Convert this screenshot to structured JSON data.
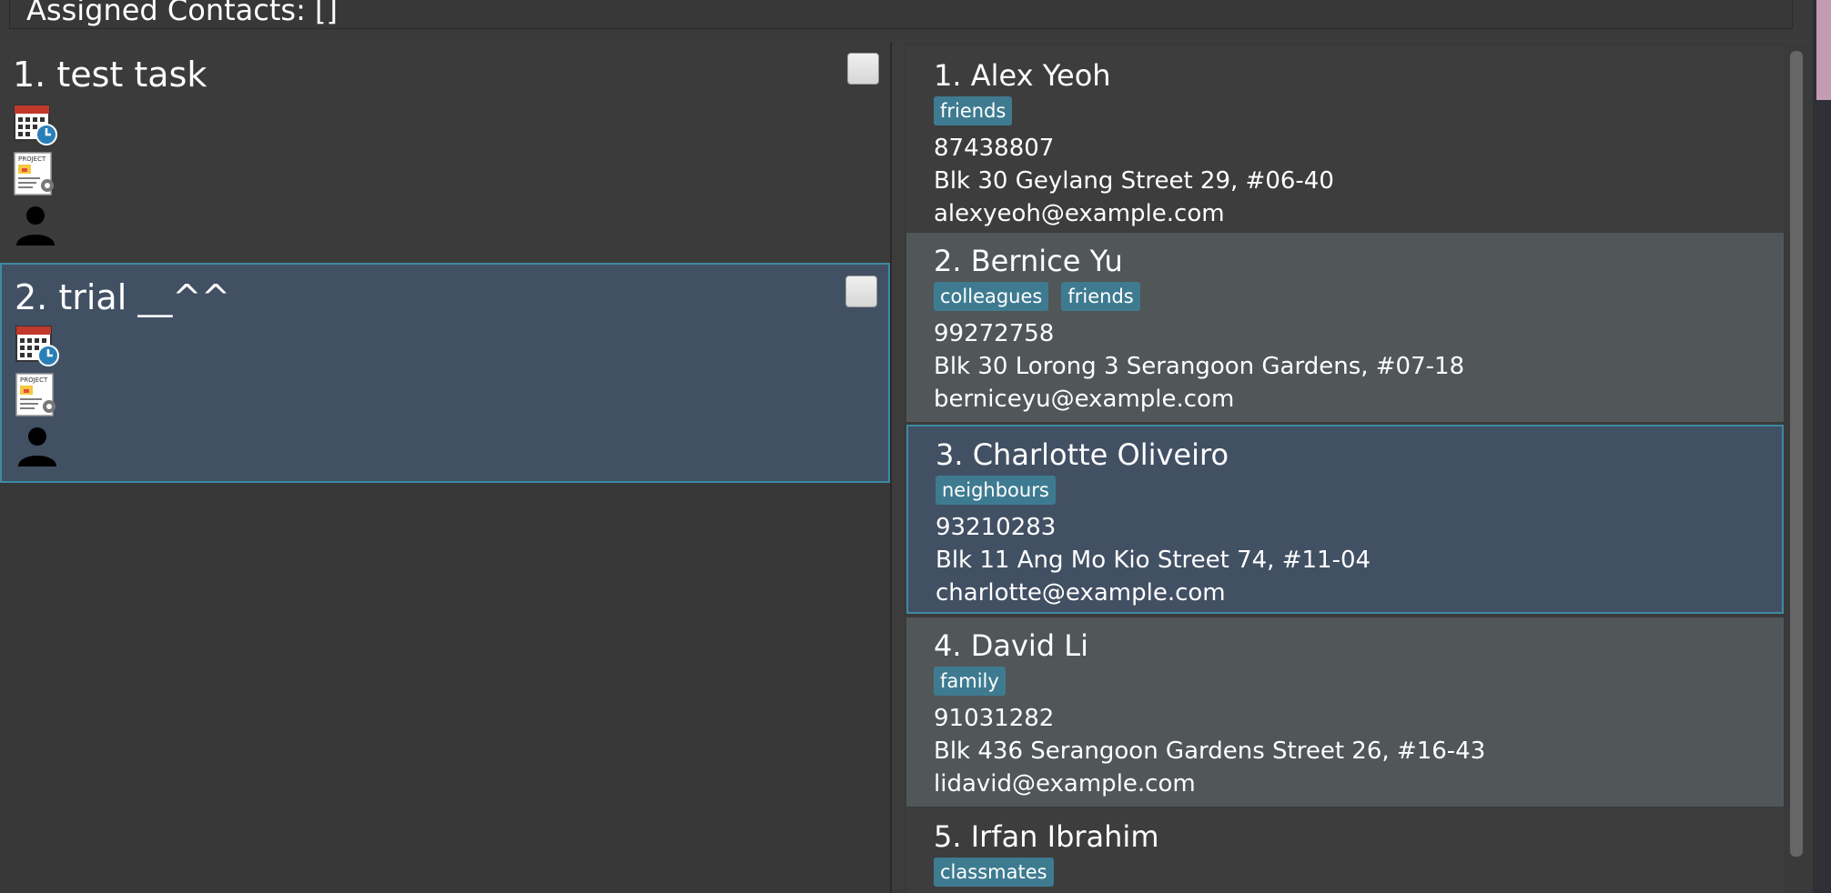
{
  "top_bar": {
    "label": "Assigned Contacts: []"
  },
  "tasks": [
    {
      "title": "1. test task"
    },
    {
      "title": "2. trial __^^"
    }
  ],
  "task_icons": [
    "calendar-clock-icon",
    "project-document-icon",
    "person-icon"
  ],
  "contacts": [
    {
      "name": "1.  Alex Yeoh",
      "tags": [
        "friends"
      ],
      "phone": "87438807",
      "address": "Blk 30 Geylang Street 29, #06-40",
      "email": "alexyeoh@example.com"
    },
    {
      "name": "2.  Bernice Yu",
      "tags": [
        "colleagues",
        "friends"
      ],
      "phone": "99272758",
      "address": "Blk 30 Lorong 3 Serangoon Gardens, #07-18",
      "email": "berniceyu@example.com"
    },
    {
      "name": "3.  Charlotte Oliveiro",
      "tags": [
        "neighbours"
      ],
      "phone": "93210283",
      "address": "Blk 11 Ang Mo Kio Street 74, #11-04",
      "email": "charlotte@example.com"
    },
    {
      "name": "4.  David Li",
      "tags": [
        "family"
      ],
      "phone": "91031282",
      "address": "Blk 436 Serangoon Gardens Street 26, #16-43",
      "email": "lidavid@example.com"
    },
    {
      "name": "5.  Irfan Ibrahim",
      "tags": [
        "classmates"
      ]
    }
  ],
  "colors": {
    "accent": "#3d8aa3",
    "tag_bg": "#3e7b91",
    "selected_bg": "#425064"
  }
}
